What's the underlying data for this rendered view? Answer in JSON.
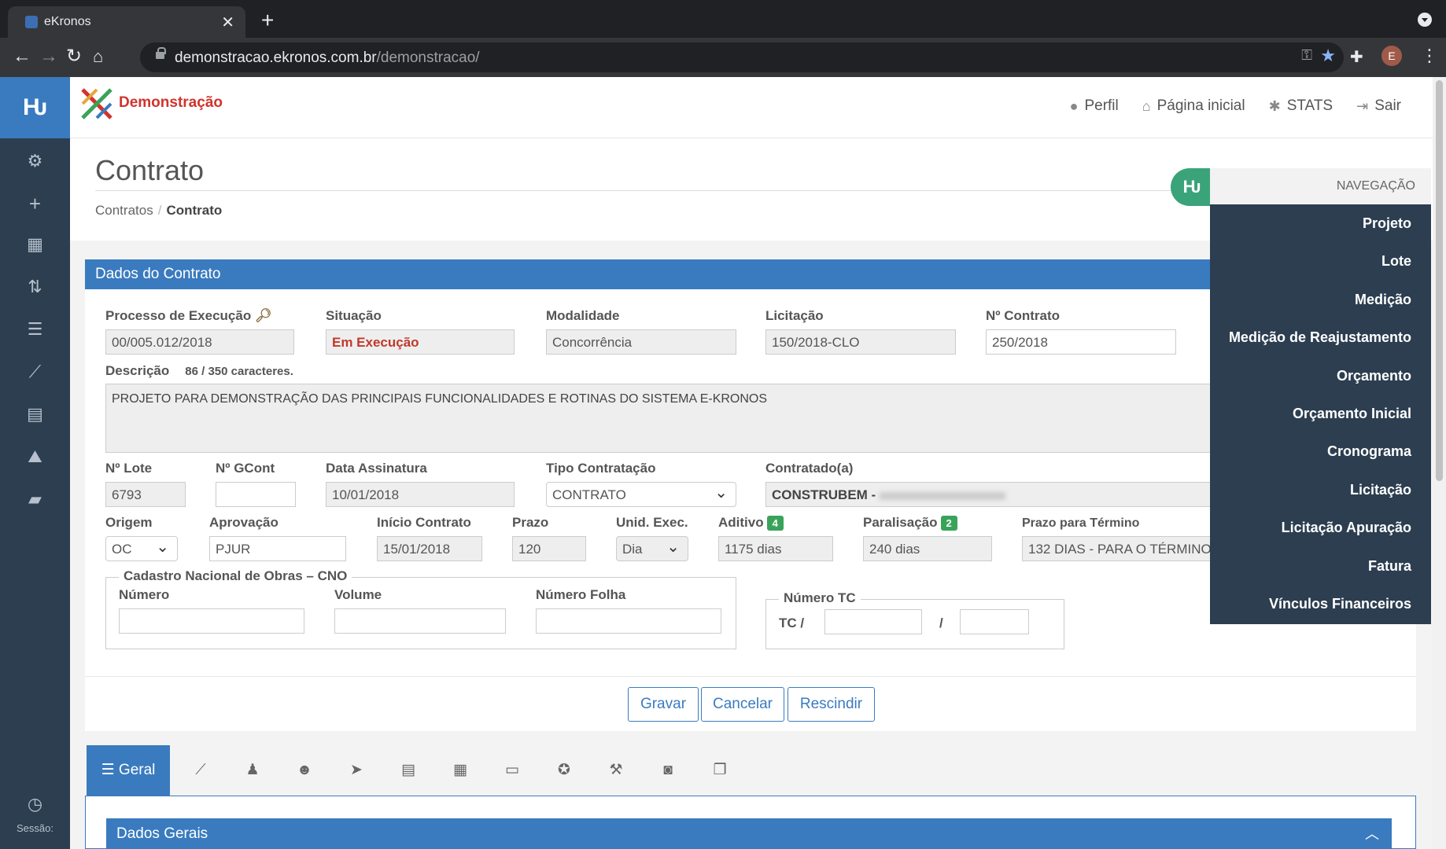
{
  "browser": {
    "tab_title": "eKronos",
    "url_host": "demonstracao.ekronos.com.br",
    "url_path": "/demonstracao/",
    "profile_initial": "E"
  },
  "app": {
    "brand_name": "Demonstração",
    "header_links": [
      {
        "label": "Perfil",
        "icon": "user-icon"
      },
      {
        "label": "Página inicial",
        "icon": "home-icon"
      },
      {
        "label": "STATS",
        "icon": "bug-icon"
      },
      {
        "label": "Sair",
        "icon": "sign-out-icon"
      }
    ],
    "session_label": "Sessão:"
  },
  "page": {
    "title": "Contrato",
    "breadcrumb": [
      "Contratos",
      "Contrato"
    ]
  },
  "form": {
    "panel_title": "Dados do Contrato",
    "processo_label": "Processo de Execução",
    "processo_value": "00/005.012/2018",
    "situacao_label": "Situação",
    "situacao_value": "Em Execução",
    "modalidade_label": "Modalidade",
    "modalidade_value": "Concorrência",
    "licitacao_label": "Licitação",
    "licitacao_value": "150/2018-CLO",
    "contrato_label": "Nº Contrato",
    "contrato_value": "250/2018",
    "descricao_label": "Descrição",
    "descricao_count": "86 / 350 caracteres.",
    "descricao_value": "PROJETO PARA DEMONSTRAÇÃO DAS PRINCIPAIS FUNCIONALIDADES E ROTINAS DO SISTEMA E-KRONOS",
    "lote_label": "Nº Lote",
    "lote_value": "6793",
    "gcont_label": "Nº GCont",
    "gcont_value": "",
    "assinatura_label": "Data Assinatura",
    "assinatura_value": "10/01/2018",
    "tipo_label": "Tipo Contratação",
    "tipo_value": "CONTRATO",
    "contratado_label": "Contratado(a)",
    "contratado_value": "CONSTRUBEM -",
    "origem_label": "Origem",
    "origem_value": "OC",
    "aprovacao_label": "Aprovação",
    "aprovacao_value": "PJUR",
    "inicio_label": "Início Contrato",
    "inicio_value": "15/01/2018",
    "prazo_label": "Prazo",
    "prazo_value": "120",
    "unid_label": "Unid. Exec.",
    "unid_value": "Dia",
    "aditivo_label": "Aditivo",
    "aditivo_badge": "4",
    "aditivo_value": "1175 dias",
    "paralisacao_label": "Paralisação",
    "paralisacao_badge": "2",
    "paralisacao_value": "240 dias",
    "termino_label": "Prazo para Término",
    "termino_value": "132 DIAS - PARA O TÉRMINO -",
    "cno_legend": "Cadastro Nacional de Obras – CNO",
    "cno_numero_label": "Número",
    "cno_volume_label": "Volume",
    "cno_folha_label": "Número Folha",
    "tc_legend": "Número TC",
    "tc_prefix": "TC /",
    "tc_sep": "/",
    "btn_gravar": "Gravar",
    "btn_cancelar": "Cancelar",
    "btn_rescindir": "Rescindir"
  },
  "tabs": {
    "active_label": "Geral",
    "icons": [
      "chart-icon",
      "person-icon",
      "users-icon",
      "send-icon",
      "document-icon",
      "calendar-icon",
      "card-icon",
      "award-icon",
      "gavel-icon",
      "camera-icon",
      "copy-icon"
    ]
  },
  "section": {
    "title": "Dados Gerais"
  },
  "navigation": {
    "title": "NAVEGAÇÃO",
    "items": [
      "Projeto",
      "Lote",
      "Medição",
      "Medição de Reajustamento",
      "Orçamento",
      "Orçamento Inicial",
      "Cronograma",
      "Licitação",
      "Licitação Apuração",
      "Fatura",
      "Vínculos Financeiros"
    ]
  },
  "colors": {
    "primary": "#3a7bbf",
    "sidebar": "#2c3e50",
    "success": "#3aa35a",
    "danger": "#c0392b"
  }
}
